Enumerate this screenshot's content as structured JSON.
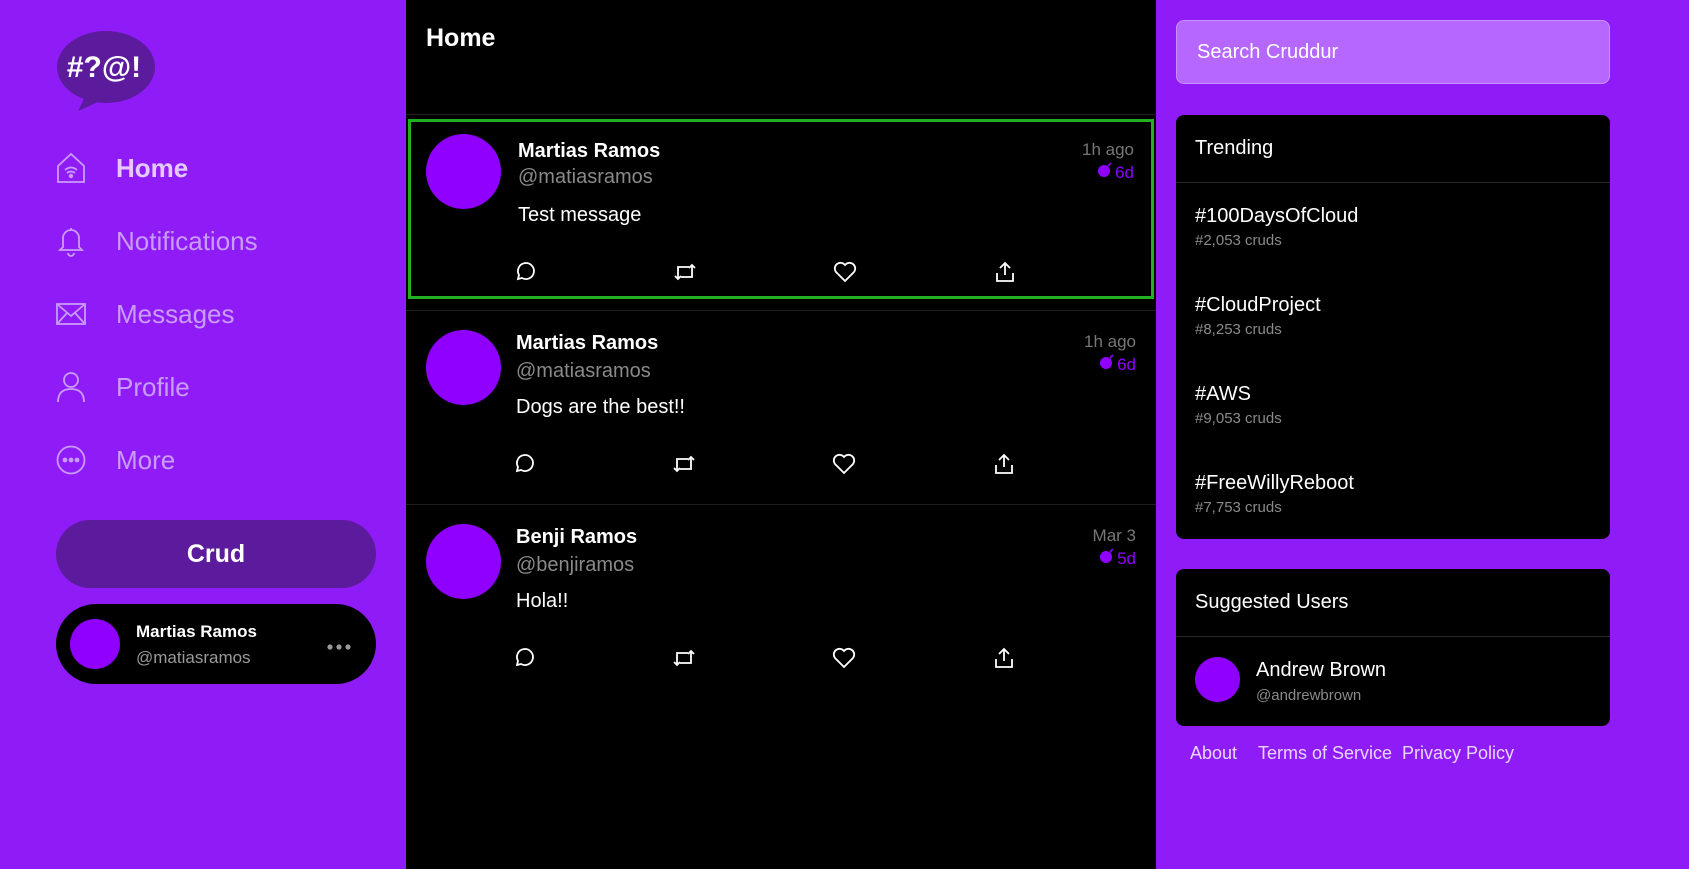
{
  "logo": {
    "text": "#?@!"
  },
  "nav": [
    {
      "label": "Home",
      "icon": "home-icon",
      "active": true
    },
    {
      "label": "Notifications",
      "icon": "bell-icon"
    },
    {
      "label": "Messages",
      "icon": "envelope-icon"
    },
    {
      "label": "Profile",
      "icon": "person-icon"
    },
    {
      "label": "More",
      "icon": "more-circle-icon"
    }
  ],
  "crud_button": "Crud",
  "current_user": {
    "name": "Martias Ramos",
    "handle": "@matiasramos",
    "more": "..."
  },
  "feed": {
    "title": "Home",
    "activities": [
      {
        "name": "Martias Ramos",
        "handle": "@matiasramos",
        "message": "Test message",
        "time": "1h ago",
        "expires": "6d",
        "selected": true
      },
      {
        "name": "Martias Ramos",
        "handle": "@matiasramos",
        "message": "Dogs are the best!!",
        "time": "1h ago",
        "expires": "6d"
      },
      {
        "name": "Benji Ramos",
        "handle": "@benjiramos",
        "message": "Hola!!",
        "time": "Mar 3",
        "expires": "5d"
      }
    ]
  },
  "search": {
    "placeholder": "Search Cruddur"
  },
  "trending": {
    "title": "Trending",
    "items": [
      {
        "tag": "#100DaysOfCloud",
        "count": "#2,053 cruds"
      },
      {
        "tag": "#CloudProject",
        "count": "#8,253 cruds"
      },
      {
        "tag": "#AWS",
        "count": "#9,053 cruds"
      },
      {
        "tag": "#FreeWillyReboot",
        "count": "#7,753 cruds"
      }
    ]
  },
  "suggested": {
    "title": "Suggested Users",
    "users": [
      {
        "name": "Andrew Brown",
        "handle": "@andrewbrown"
      }
    ]
  },
  "footer": {
    "about": "About",
    "terms": "Terms of Service",
    "privacy": "Privacy Policy"
  },
  "colors": {
    "background": "#8f1cf6",
    "avatar": "#8f00ff",
    "feed_bg": "#000000",
    "selected_border": "#22b022"
  }
}
